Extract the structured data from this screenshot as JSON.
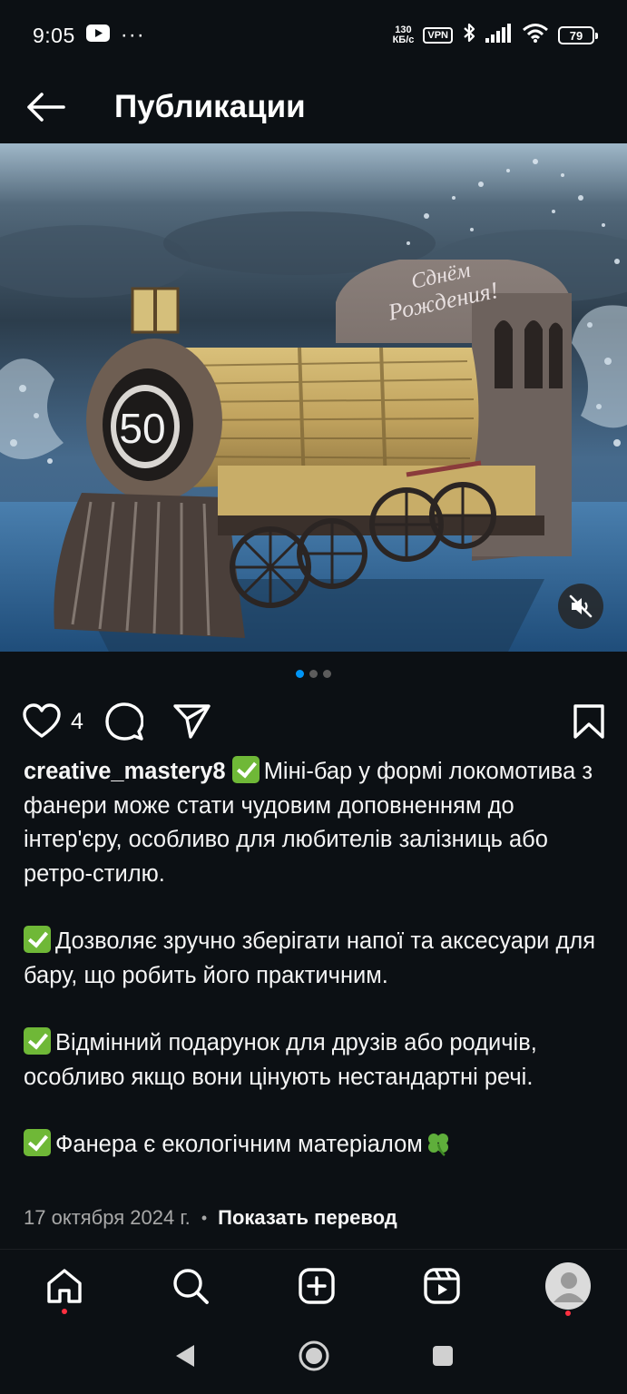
{
  "status_bar": {
    "time": "9:05",
    "more": "···",
    "net_speed_value": "130",
    "net_speed_unit": "КБ/с",
    "vpn": "VPN",
    "battery": "79"
  },
  "header": {
    "title": "Публикации"
  },
  "media": {
    "number_plate": "50",
    "sign_line1": "Сднём",
    "sign_line2": "Рождения!",
    "carousel_count": 3,
    "carousel_active": 1
  },
  "actions": {
    "like_count": "4"
  },
  "post": {
    "username": "creative_mastery8",
    "caption_1": "Міні-бар у формі локомотива з фанери може стати чудовим доповненням до інтер'єру, особливо для любителів залізниць або ретро-стилю.",
    "caption_2": "Дозволяє зручно зберігати напої та аксесуари для бару, що робить його практичним.",
    "caption_3": "Відмінний подарунок для друзів або родичів, особливо якщо вони цінують нестандартні речі.",
    "caption_4": "Фанера є екологічним матеріалом",
    "date": "17 октября 2024 г.",
    "separator": "•",
    "translate": "Показать перевод"
  },
  "icons": {
    "back": "arrow-left-icon",
    "like": "heart-icon",
    "comment": "comment-bubble-icon",
    "share": "paper-plane-icon",
    "save": "bookmark-icon",
    "mute": "speaker-muted-icon",
    "check": "green-check-emoji",
    "clover": "four-leaf-clover-emoji"
  },
  "colors": {
    "background": "#0c1014",
    "accent_blue": "#0095f6",
    "notification_red": "#ff3040",
    "check_green": "#6fb837",
    "muted_text": "#a8a8a8"
  }
}
